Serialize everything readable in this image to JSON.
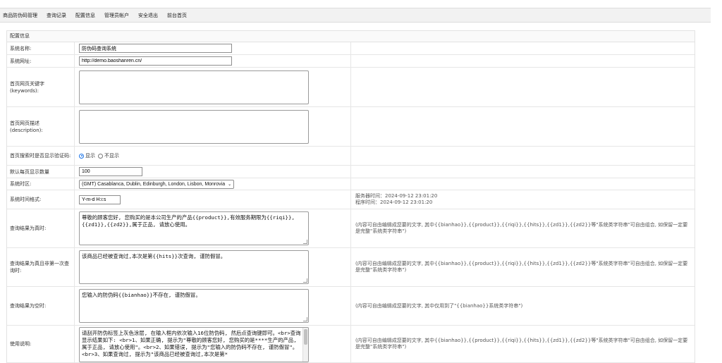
{
  "nav": [
    {
      "label": "商品防伪码管理"
    },
    {
      "label": "查询记录"
    },
    {
      "label": "配置信息"
    },
    {
      "label": "管理员帐户"
    },
    {
      "label": "安全退出"
    },
    {
      "label": "前台首页"
    }
  ],
  "panel_title": "配置信息",
  "site_name": {
    "label": "系统名称:",
    "value": "防伪码查询系统"
  },
  "site_url": {
    "label": "系统网址:",
    "value": "http://demo.baoshanren.cn/"
  },
  "keywords": {
    "label": "首页网页关键字(keywords):",
    "value": ""
  },
  "description": {
    "label": "首页网页描述(description):",
    "value": ""
  },
  "captcha": {
    "label": "首页搜索时是否显示验证码:",
    "options": [
      "显示",
      "不显示"
    ],
    "selected": "显示"
  },
  "page_size": {
    "label": "默认每页显示数量",
    "value": "100"
  },
  "timezone": {
    "label": "系统时区:",
    "value": "(GMT) Casablanca, Dublin, Edinburgh, London, Lisbon, Monrovia"
  },
  "time_format": {
    "label": "系统时间格式:",
    "value": "Y-m-d H:i:s",
    "server_time": "服务器时间：2024-09-12 23:01:20",
    "program_time": "程序时间：2024-09-12 23:01:20"
  },
  "result_true": {
    "label": "查询结果为真时:",
    "value": "尊敬的顾客您好, 您购买的是本公司生产的产品{{product}},有效服务期限为{{riqi}}, {{zd1}},{{zd2}},属于正品, 请放心使用。",
    "note": "(内容可自由编辑成您要的文字, 其中{{bianhao}},{{product}},{{riqi}},{{hits}},{{zd1}},{{zd2}}等\"系统类字符串\"可自由组合, 如保留一定要是完整\"系统类字符串\")"
  },
  "result_repeat": {
    "label": "查询结果为真且非第一次查询时:",
    "value": "该商品已经被查询过,本次是第{{hits}}次查询, 谨防假冒。",
    "note": "(内容可自由编辑成您要的文字, 其中{{bianhao}},{{product}},{{riqi}},{{hits}},{{zd1}},{{zd2}}等\"系统类字符串\"可自由组合, 如保留一定要是完整\"系统类字符串\")"
  },
  "result_empty": {
    "label": "查询结果为空时:",
    "value": "您输入的防伪码{{bianhao}}不存在, 谨防假冒。",
    "note": "(内容可自由编辑成您要的文字, 其中仅用到了\"{{bianhao}}系统类字符串\")"
  },
  "usage": {
    "label": "使用说明:",
    "value": "请刮开防伪标签上灰色涂层, 在输入框内依次输入16位防伪码, 然后点查询键即可。<br>查询显示结果如下: <br>1、如果正确, 提示为\"尊敬的顾客您好, 您购买的是****生产的产品, 属于正品, 请放心使用\"。<br>2、如果错误, 提示为\"您输入的防伪码不存在, 谨防假冒\"。<br>3、如果查询过, 提示为\"该商品已经被查询过,本次是第*",
    "note": "(内容可自由编辑成您要的文字, 其中{{bianhao}},{{product}},{{riqi}},{{hits}},{{zd1}},{{zd2}}等\"系统类字符串\"可自由组合, 如保留一定要是完整\"系统类字符串\")"
  }
}
